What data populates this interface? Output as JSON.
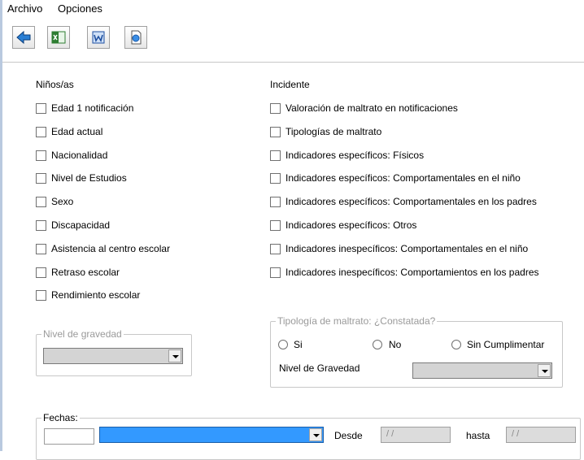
{
  "menu": {
    "file": "Archivo",
    "options": "Opciones"
  },
  "toolbar": [
    {
      "name": "back-icon"
    },
    {
      "name": "excel-icon"
    },
    {
      "name": "word-icon"
    },
    {
      "name": "preview-icon"
    }
  ],
  "ninos": {
    "title": "Niños/as",
    "items": [
      "Edad 1 notificación",
      "Edad actual",
      "Nacionalidad",
      "Nivel de Estudios",
      "Sexo",
      "Discapacidad",
      "Asistencia al centro escolar",
      "Retraso escolar",
      "Rendimiento escolar"
    ]
  },
  "incidente": {
    "title": "Incidente",
    "items": [
      "Valoración de maltrato en notificaciones",
      "Tipologías de maltrato",
      "Indicadores específicos: Físicos",
      "Indicadores específicos: Comportamentales en el niño",
      "Indicadores específicos: Comportamentales en los padres",
      "Indicadores específicos: Otros",
      "Indicadores inespecíficos: Comportamentales en el niño",
      "Indicadores inespecíficos: Comportamientos en los padres"
    ]
  },
  "nivel_gravedad_group": {
    "title": "Nivel de gravedad",
    "selected": ""
  },
  "tipologia_group": {
    "title": "Tipología de maltrato: ¿Constatada?",
    "options": [
      "Si",
      "No",
      "Sin Cumplimentar"
    ],
    "gravedad_label": "Nivel de Gravedad",
    "gravedad_selected": ""
  },
  "fechas": {
    "title": "Fechas:",
    "from_label": "Desde",
    "to_label": "hasta",
    "from_value": "/ /",
    "to_value": "/ /",
    "highlight_color": "#3399ff"
  }
}
